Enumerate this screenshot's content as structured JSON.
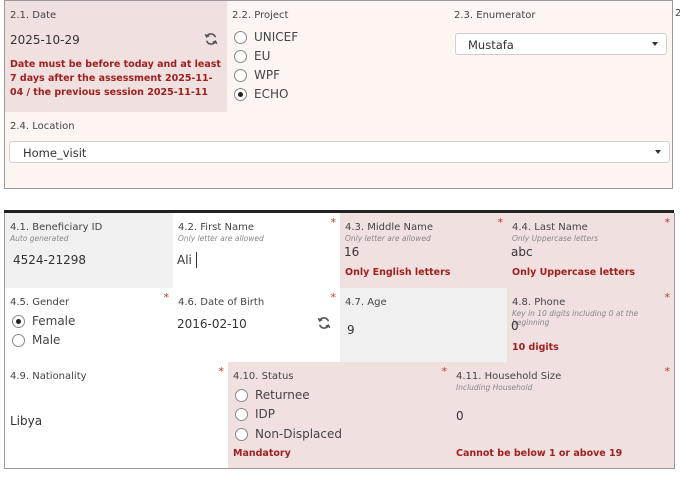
{
  "section2": {
    "date": {
      "label": "2.1. Date",
      "value": "2025-10-29",
      "error": "Date must be before today and at least 7 days after the assessment 2025-11-04 / the previous session 2025-11-11"
    },
    "project": {
      "label": "2.2. Project",
      "options": [
        {
          "label": "UNICEF",
          "selected": false
        },
        {
          "label": "EU",
          "selected": false
        },
        {
          "label": "WPF",
          "selected": false
        },
        {
          "label": "ECHO",
          "selected": true
        }
      ]
    },
    "enumerator": {
      "label": "2.3. Enumerator",
      "value": "Mustafa"
    },
    "edge_label": "2",
    "location": {
      "label": "2.4. Location",
      "value": "Home_visit"
    }
  },
  "section4": {
    "beneficiary_id": {
      "label": "4.1. Beneficiary ID",
      "hint": "Auto generated",
      "value": "4524-21298"
    },
    "first_name": {
      "label": "4.2. First Name",
      "hint": "Only letter are allowed",
      "value": "Ali",
      "required": "*"
    },
    "middle_name": {
      "label": "4.3. Middle Name",
      "hint": "Only letter are allowed",
      "value": "16",
      "required": "*",
      "error": "Only English letters"
    },
    "last_name": {
      "label": "4.4. Last Name",
      "hint": "Only Uppercase letters",
      "value": "abc",
      "required": "*",
      "error": "Only Uppercase letters"
    },
    "gender": {
      "label": "4.5. Gender",
      "required": "*",
      "options": [
        {
          "label": "Female",
          "selected": true
        },
        {
          "label": "Male",
          "selected": false
        }
      ]
    },
    "dob": {
      "label": "4.6. Date of Birth",
      "value": "2016-02-10",
      "required": "*"
    },
    "age": {
      "label": "4.7. Age",
      "value": "9"
    },
    "phone": {
      "label": "4.8. Phone",
      "hint": "Key in 10 digits including 0 at the beginning",
      "value": "0",
      "required": "*",
      "error": "10 digits"
    },
    "nationality": {
      "label": "4.9. Nationality",
      "value": "Libya",
      "required": "*"
    },
    "status": {
      "label": "4.10. Status",
      "required": "*",
      "options": [
        {
          "label": "Returnee",
          "selected": false
        },
        {
          "label": "IDP",
          "selected": false
        },
        {
          "label": "Non-Displaced",
          "selected": false
        }
      ],
      "error": "Mandatory"
    },
    "household": {
      "label": "4.11. Household Size",
      "hint": "Including Household",
      "value": "0",
      "required": "*",
      "error": "Cannot be below 1 or above 19"
    }
  },
  "colors": {
    "error": "#a02020",
    "pink": "#f1e0e0",
    "cream": "#fdf5f1",
    "grey": "#f0f0f0"
  }
}
